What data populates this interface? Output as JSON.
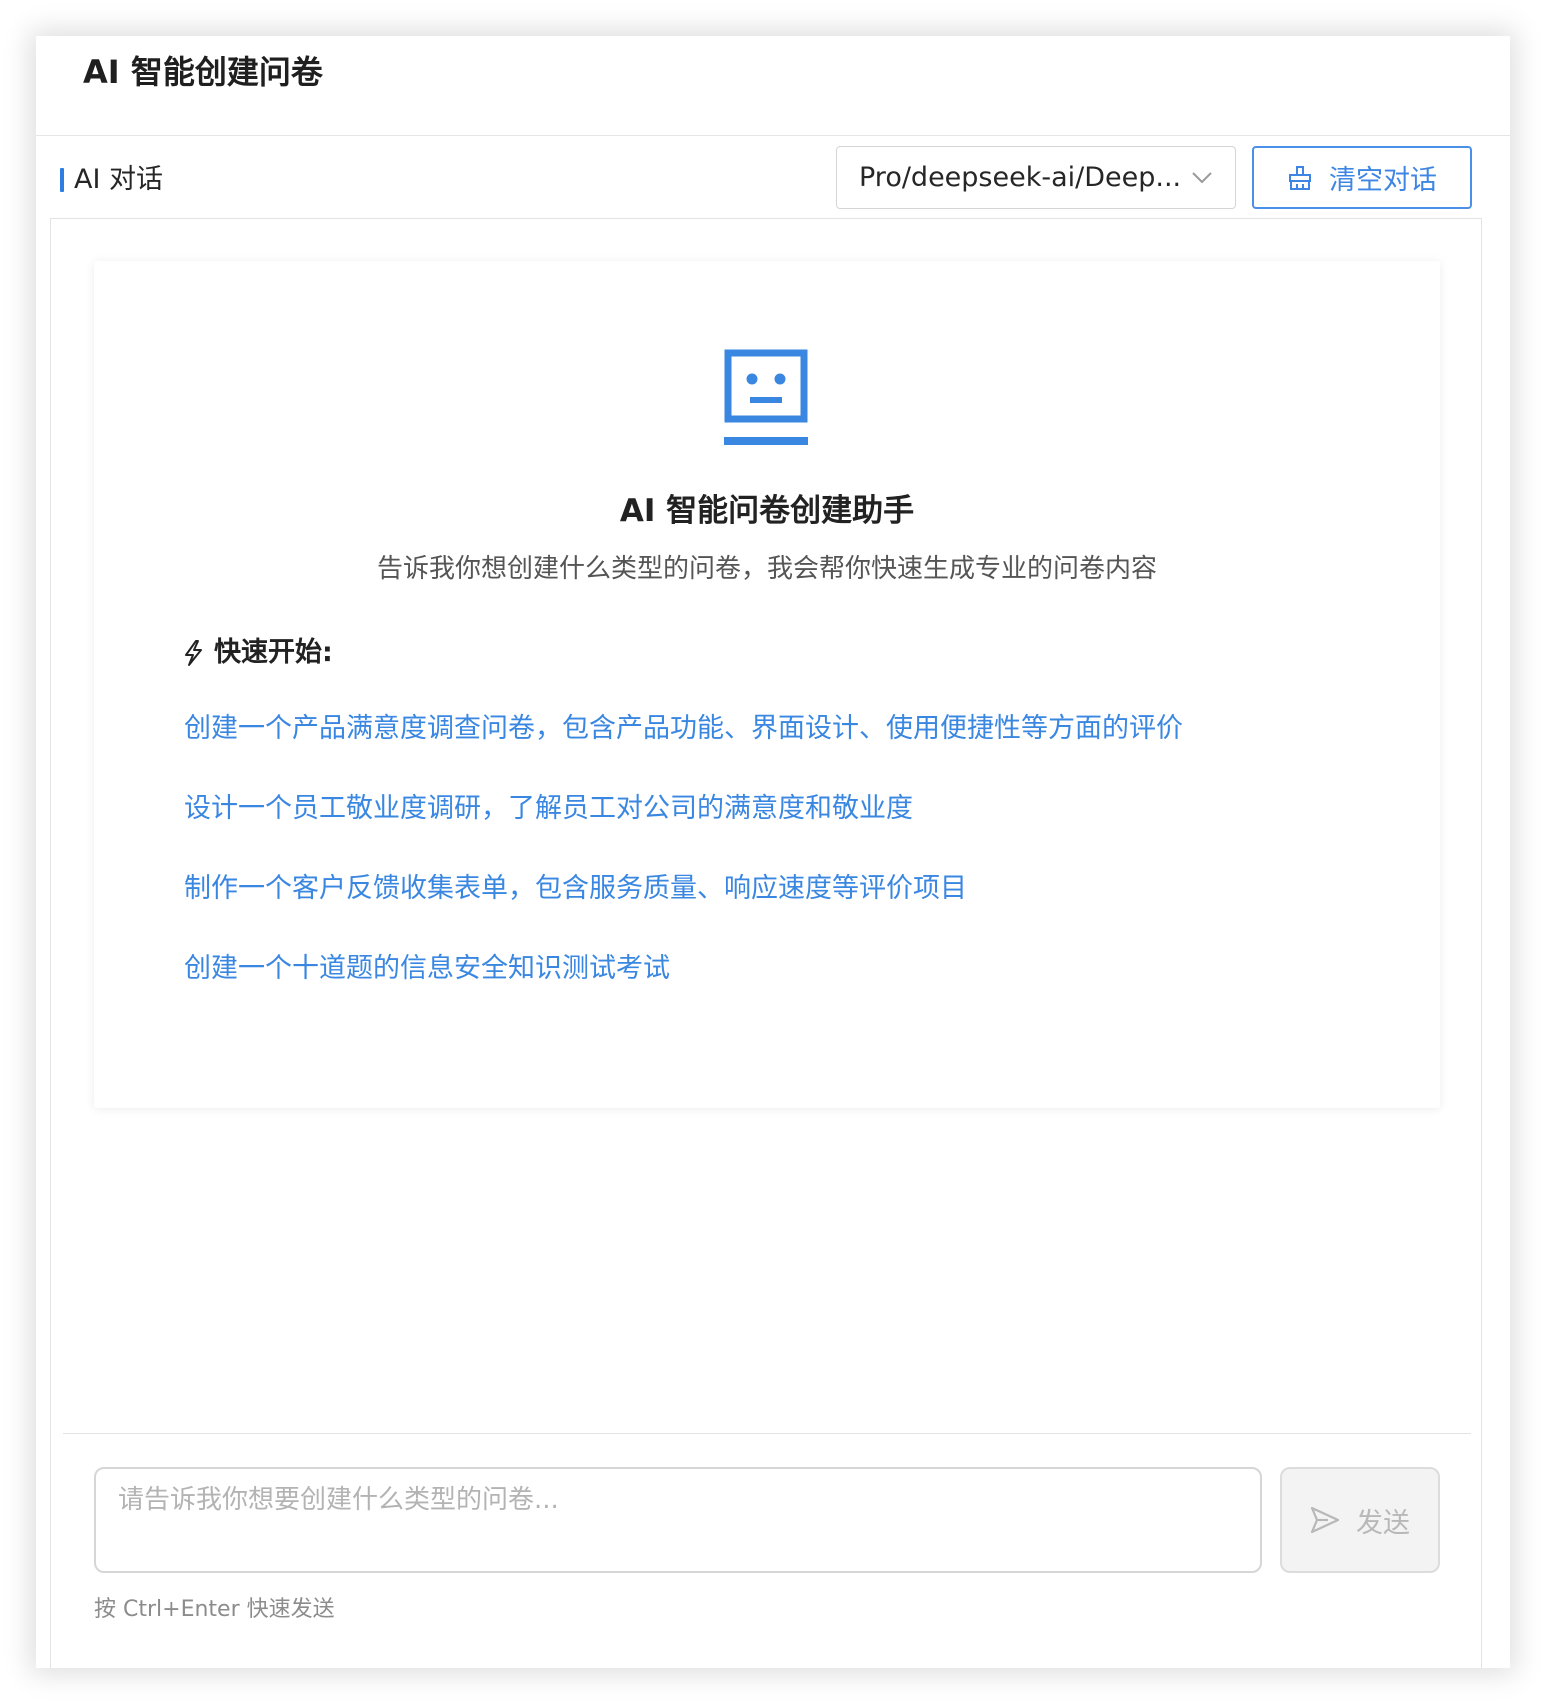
{
  "header": {
    "title": "AI 智能创建问卷"
  },
  "toolbar": {
    "section_label": "AI 对话",
    "model_select": {
      "value": "Pro/deepseek-ai/Deep..."
    },
    "clear_button": "清空对话"
  },
  "welcome": {
    "title": "AI 智能问卷创建助手",
    "subtitle": "告诉我你想创建什么类型的问卷，我会帮你快速生成专业的问卷内容",
    "quick_start_label": "快速开始:",
    "suggestions": [
      "创建一个产品满意度调查问卷，包含产品功能、界面设计、使用便捷性等方面的评价",
      "设计一个员工敬业度调研，了解员工对公司的满意度和敬业度",
      "制作一个客户反馈收集表单，包含服务质量、响应速度等评价项目",
      "创建一个十道题的信息安全知识测试考试"
    ]
  },
  "composer": {
    "placeholder": "请告诉我你想要创建什么类型的问卷...",
    "value": "",
    "send_button": "发送",
    "hint": "按 Ctrl+Enter 快速发送"
  },
  "colors": {
    "accent": "#2f7de1",
    "link": "#3a87e2",
    "disabled": "#b8b8b8"
  },
  "icons": {
    "robot": "robot-icon",
    "broom": "broom-icon",
    "chevron": "chevron-down-icon",
    "lightning": "lightning-icon",
    "send": "send-icon"
  }
}
